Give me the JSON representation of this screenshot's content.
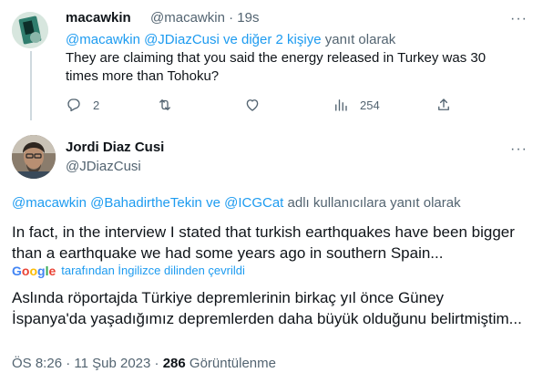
{
  "tweet1": {
    "name": "macawkin",
    "handle": "@macawkin",
    "sep": "·",
    "time": "19s",
    "more": "···",
    "reply_mentions": "@macawkin @JDiazCusi",
    "reply_others": "ve diğer 2 kişiye",
    "reply_suffix": "yanıt olarak",
    "text": "They are claiming that you said the energy released in Turkey was 30 times more than Tohoku?",
    "actions": {
      "replies": "2",
      "retweets": "",
      "likes": "",
      "views": "254"
    }
  },
  "tweet2": {
    "name": "Jordi Diaz Cusi",
    "handle": "@JDiazCusi",
    "more": "···",
    "reply_m1": "@macawkin",
    "reply_m2": "@BahadirtheTekin",
    "reply_ve": "ve",
    "reply_m3": "@ICGCat",
    "reply_suffix": "adlı kullanıcılara yanıt olarak",
    "text": "In fact, in the interview I stated that turkish earthquakes have been bigger than a earthquake we had some years ago in southern Spain...",
    "translate_note": "tarafından İngilizce dilinden çevrildi",
    "translated": "Aslında röportajda Türkiye depremlerinin birkaç yıl önce Güney İspanya'da yaşadığımız depremlerden daha büyük olduğunu belirtmiştim...",
    "time": "ÖS 8:26",
    "dot": "·",
    "date": "11 Şub 2023",
    "views_count": "286",
    "views_label": "Görüntülenme"
  },
  "google_logo": [
    "G",
    "o",
    "o",
    "g",
    "l",
    "e"
  ],
  "google_colors": [
    "#4285f4",
    "#ea4335",
    "#fbbc05",
    "#4285f4",
    "#34a853",
    "#ea4335"
  ]
}
